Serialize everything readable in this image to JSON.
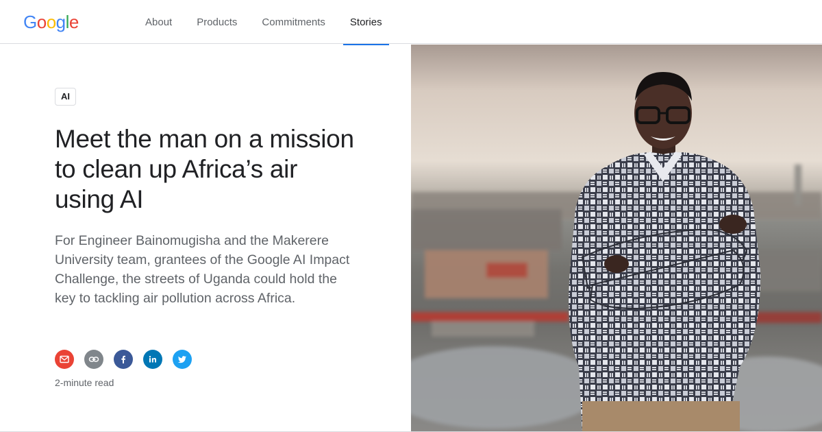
{
  "header": {
    "logo_letters": [
      {
        "char": "G",
        "color": "#4285F4"
      },
      {
        "char": "o",
        "color": "#EA4335"
      },
      {
        "char": "o",
        "color": "#FBBC05"
      },
      {
        "char": "g",
        "color": "#4285F4"
      },
      {
        "char": "l",
        "color": "#34A853"
      },
      {
        "char": "e",
        "color": "#EA4335"
      }
    ],
    "nav": [
      {
        "label": "About",
        "active": false
      },
      {
        "label": "Products",
        "active": false
      },
      {
        "label": "Commitments",
        "active": false
      },
      {
        "label": "Stories",
        "active": true
      }
    ],
    "accent_color": "#1a73e8"
  },
  "article": {
    "tag": "AI",
    "title": "Meet the man on a mission to clean up Africa’s air using AI",
    "summary": "For Engineer Bainomugisha and the Makerere University team, grantees of the Google AI Impact Challenge, the streets of Uganda could hold the key to tackling air pollution across Africa.",
    "share": [
      {
        "icon": "email-icon",
        "color": "#ea4335"
      },
      {
        "icon": "link-icon",
        "color": "#80868b"
      },
      {
        "icon": "facebook-icon",
        "color": "#3b5998"
      },
      {
        "icon": "linkedin-icon",
        "color": "#0077b5"
      },
      {
        "icon": "twitter-icon",
        "color": "#1da1f2"
      }
    ],
    "read_time": "2-minute read"
  }
}
